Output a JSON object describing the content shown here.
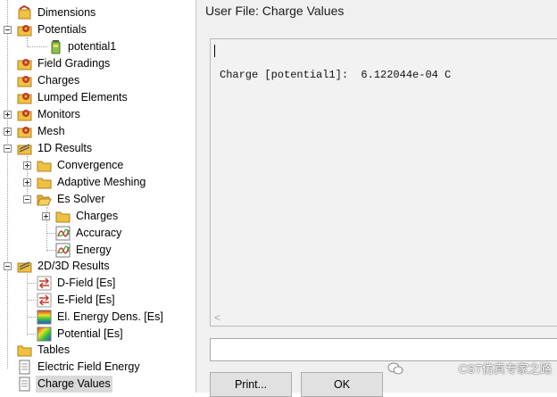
{
  "tree": {
    "items": [
      {
        "label": "Dimensions",
        "icon": "dimensions-icon"
      },
      {
        "label": "Potentials",
        "icon": "potentials-folder-icon"
      },
      {
        "label": "potential1",
        "icon": "battery-icon"
      },
      {
        "label": "Field Gradings",
        "icon": "gear-folder-icon"
      },
      {
        "label": "Charges",
        "icon": "gear-folder-icon"
      },
      {
        "label": "Lumped Elements",
        "icon": "gear-folder-icon"
      },
      {
        "label": "Monitors",
        "icon": "gear-folder-icon"
      },
      {
        "label": "Mesh",
        "icon": "gear-folder-icon"
      },
      {
        "label": "1D Results",
        "icon": "results-icon"
      },
      {
        "label": "Convergence",
        "icon": "folder-icon"
      },
      {
        "label": "Adaptive Meshing",
        "icon": "folder-icon"
      },
      {
        "label": "Es Solver",
        "icon": "open-folder-icon"
      },
      {
        "label": "Charges",
        "icon": "folder-icon"
      },
      {
        "label": "Accuracy",
        "icon": "plot-icon"
      },
      {
        "label": "Energy",
        "icon": "plot-icon"
      },
      {
        "label": "2D/3D Results",
        "icon": "results-icon"
      },
      {
        "label": "D-Field [Es]",
        "icon": "vector-field-icon"
      },
      {
        "label": "E-Field [Es]",
        "icon": "vector-field-icon"
      },
      {
        "label": "El. Energy Dens. [Es]",
        "icon": "scalar-field-icon"
      },
      {
        "label": "Potential [Es]",
        "icon": "scalar-field-icon"
      },
      {
        "label": "Tables",
        "icon": "folder-icon"
      },
      {
        "label": "Electric Field Energy",
        "icon": "document-icon"
      },
      {
        "label": "Charge Values",
        "icon": "document-icon"
      }
    ]
  },
  "panel": {
    "title": "User File: Charge Values",
    "output_line": "Charge [potential1]:  6.122044e-04 C",
    "scroll_left": "<",
    "print_label": "Print...",
    "ok_label": "OK"
  },
  "watermark": {
    "text": "CST仿真专家之路"
  },
  "colors": {
    "folder": "#f0c040",
    "gear": "#c0392b",
    "selection": "#d9d9d9",
    "panel_bg": "#f0f0f0"
  }
}
